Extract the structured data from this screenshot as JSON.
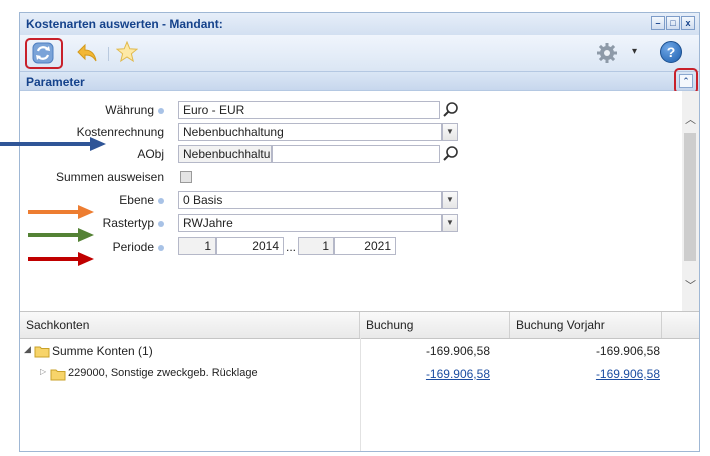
{
  "window": {
    "title": "Kostenarten auswerten - Mandant:"
  },
  "window_buttons": [
    "–",
    "□",
    "x"
  ],
  "toolbar": {
    "refresh_icon": "refresh-icon",
    "back_icon": "arrow-back-icon",
    "favorite_icon": "star-icon",
    "settings_icon": "gear-icon",
    "settings_dropdown": "▾",
    "help_icon": "help-icon",
    "help_label": "?"
  },
  "panel": {
    "title": "Parameter",
    "collapse_glyph": "⌃"
  },
  "params": {
    "waehrung": {
      "label": "Währung",
      "value": "Euro - EUR"
    },
    "kostenrechnung": {
      "label": "Kostenrechnung",
      "value": "Nebenbuchhaltung"
    },
    "aobj": {
      "label": "AObj",
      "value": "Nebenbuchhaltu"
    },
    "summen": {
      "label": "Summen ausweisen"
    },
    "ebene": {
      "label": "Ebene",
      "value": "0 Basis"
    },
    "rastertyp": {
      "label": "Rastertyp",
      "value": "RWJahre"
    },
    "periode": {
      "label": "Periode",
      "from_period": "1",
      "from_year": "2014",
      "ellipsis": "...",
      "to_period": "1",
      "to_year": "2021"
    }
  },
  "grid": {
    "columns": [
      "Sachkonten",
      "Buchung",
      "Buchung Vorjahr"
    ],
    "rows": [
      {
        "expander": "◢",
        "label": "Summe Konten (1)",
        "buchung": "-169.906,58",
        "vorjahr": "-169.906,58"
      },
      {
        "expander": "▷",
        "label": "229000, Sonstige zweckgeb. Rücklage",
        "buchung": "-169.906,58",
        "vorjahr": "-169.906,58"
      }
    ]
  },
  "colors": {
    "arrow_blue": "#2f5597",
    "arrow_orange": "#ed7d31",
    "arrow_green": "#548235",
    "arrow_red": "#c00000",
    "highlight_red": "#c8202a",
    "title_blue": "#15428b"
  }
}
